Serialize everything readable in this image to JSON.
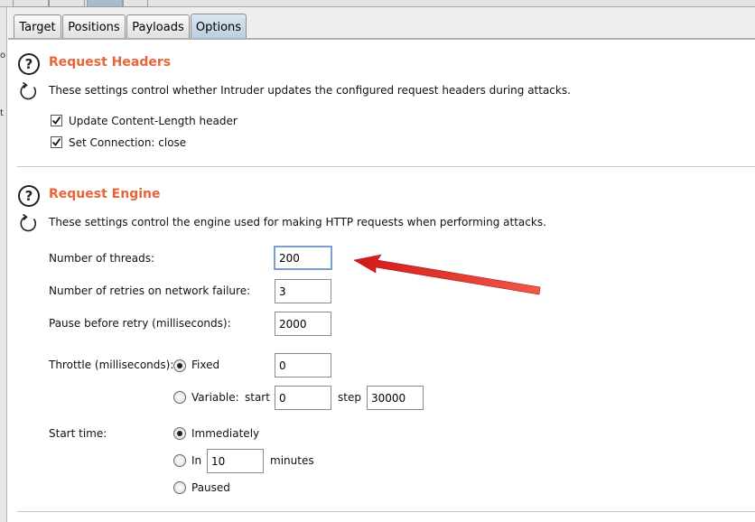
{
  "tabs": [
    {
      "label": "Target",
      "active": false
    },
    {
      "label": "Positions",
      "active": false
    },
    {
      "label": "Payloads",
      "active": false
    },
    {
      "label": "Options",
      "active": true
    }
  ],
  "left_strip_fragments": [
    "o",
    "t"
  ],
  "request_headers": {
    "title": "Request Headers",
    "description": "These settings control whether Intruder updates the configured request headers during attacks.",
    "checkboxes": [
      {
        "label": "Update Content-Length header",
        "checked": true
      },
      {
        "label": "Set Connection: close",
        "checked": true
      }
    ]
  },
  "request_engine": {
    "title": "Request Engine",
    "description": "These settings control the engine used for making HTTP requests when performing attacks.",
    "threads": {
      "label": "Number of threads:",
      "value": "200"
    },
    "retries": {
      "label": "Number of retries on network failure:",
      "value": "3"
    },
    "pause": {
      "label": "Pause before retry (milliseconds):",
      "value": "2000"
    },
    "throttle": {
      "label": "Throttle (milliseconds):",
      "fixed_label": "Fixed",
      "fixed_value": "0",
      "fixed_selected": true,
      "variable_label": "Variable:",
      "start_label": "start",
      "start_value": "0",
      "step_label": "step",
      "step_value": "30000"
    },
    "start_time": {
      "label": "Start time:",
      "immediately_label": "Immediately",
      "immediately_selected": true,
      "in_label": "In",
      "in_value": "10",
      "minutes_label": "minutes",
      "paused_label": "Paused"
    }
  },
  "annotation": {
    "color": "#e02020"
  }
}
